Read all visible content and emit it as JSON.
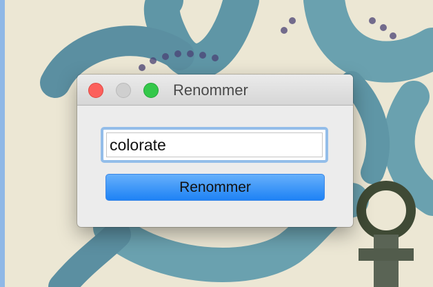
{
  "dialog": {
    "title": "Renommer",
    "window_controls": [
      "close",
      "minimize",
      "zoom"
    ]
  },
  "form": {
    "name_value": "colorate",
    "submit_label": "Renommer"
  },
  "colors": {
    "close": "#fc605c",
    "minimize": "#cfcfcf",
    "zoom": "#34c84a",
    "button_blue": "#1e82f5",
    "focus_ring": "#93bde9"
  }
}
